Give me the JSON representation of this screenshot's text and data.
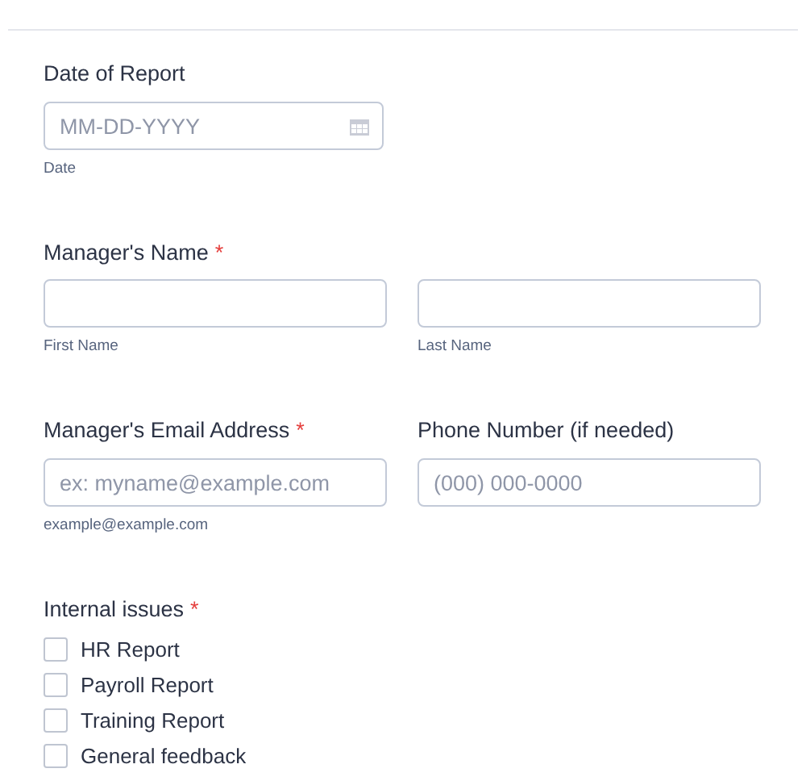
{
  "sections": [
    {
      "kind": "date",
      "label": "Date of Report",
      "fields": [
        {
          "placeholder": "MM-DD-YYYY",
          "sublabel": "Date"
        }
      ]
    },
    {
      "kind": "pair",
      "label": "Manager's Name",
      "required_mark": "*",
      "fields": [
        {
          "sublabel": "First Name"
        },
        {
          "sublabel": "Last Name"
        }
      ]
    },
    {
      "kind": "labeled-pair",
      "columns": [
        {
          "label": "Manager's Email Address",
          "required_mark": "*",
          "field": {
            "placeholder": "ex: myname@example.com",
            "sublabel": "example@example.com"
          }
        },
        {
          "label": "Phone Number (if needed)",
          "field": {
            "placeholder": "(000) 000-0000"
          }
        }
      ]
    },
    {
      "kind": "checklist",
      "label": "Internal issues",
      "required_mark": "*",
      "options": [
        {
          "label": "HR Report",
          "checked": false
        },
        {
          "label": "Payroll Report",
          "checked": false
        },
        {
          "label": "Training Report",
          "checked": false
        },
        {
          "label": "General feedback",
          "checked": false
        }
      ]
    }
  ]
}
